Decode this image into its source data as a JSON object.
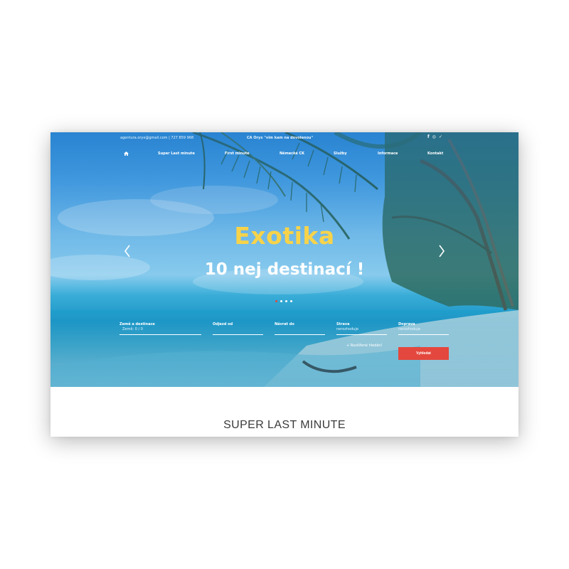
{
  "topbar": {
    "email": "agentura.oryx@gmail.com",
    "separator": "|",
    "phone": "727 859 968",
    "slogan": "CA Oryx \"vím kam na dovolenou\"",
    "social": [
      {
        "icon": "facebook-icon",
        "glyph": "f"
      },
      {
        "icon": "instagram-icon",
        "glyph": "◎"
      },
      {
        "icon": "twitter-icon",
        "glyph": "✓"
      }
    ]
  },
  "nav": {
    "home_icon": "home-icon",
    "items": [
      "Super Last minute",
      "First minute",
      "Německé CK",
      "Služby",
      "Informace",
      "Kontakt"
    ]
  },
  "slider": {
    "title": "Exotika",
    "subtitle": "10 nej destinací !",
    "slides_total": 4,
    "active_slide": 1,
    "title_color": "#f7d34a"
  },
  "search": {
    "fields": [
      {
        "label": "Země a destinace",
        "value": "Země: 0 / 0"
      },
      {
        "label": "Odjezd od",
        "value": ""
      },
      {
        "label": "Návrat do",
        "value": ""
      },
      {
        "label": "Strava",
        "value": "nerozhoduje"
      },
      {
        "label": "Doprava",
        "value": "nerozhoduje"
      }
    ],
    "advanced_label": "+ Rozšířené hledání",
    "button_label": "Vyhledat",
    "button_color": "#e4473d"
  },
  "section": {
    "title": "SUPER LAST MINUTE"
  }
}
